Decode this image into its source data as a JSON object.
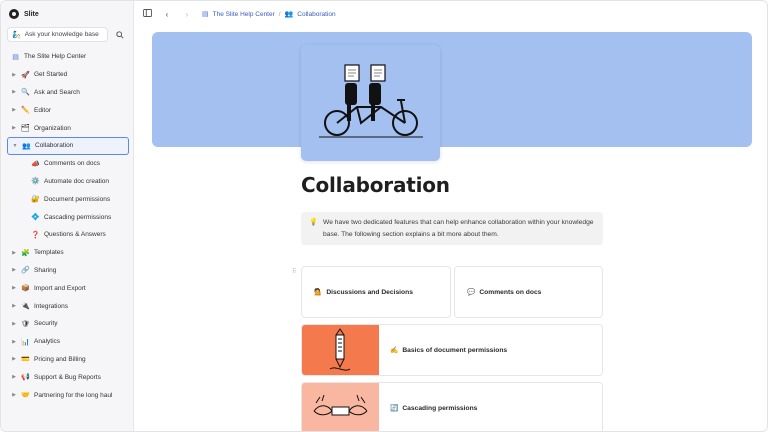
{
  "brand": {
    "name": "Slite"
  },
  "search": {
    "label": "Ask your knowledge base"
  },
  "sidebar": {
    "root": {
      "label": "The Slite Help Center"
    },
    "items": [
      {
        "label": "Get Started",
        "icon": "🚀"
      },
      {
        "label": "Ask and Search",
        "icon": "🔍"
      },
      {
        "label": "Editor",
        "icon": "✏️"
      },
      {
        "label": "Organization",
        "icon": "🗂"
      },
      {
        "label": "Collaboration",
        "icon": "👥"
      },
      {
        "label": "Comments on docs",
        "icon": "📣"
      },
      {
        "label": "Automate doc creation",
        "icon": "⚙️"
      },
      {
        "label": "Document permissions",
        "icon": "🔐"
      },
      {
        "label": "Cascading permissions",
        "icon": "💠"
      },
      {
        "label": "Questions & Answers",
        "icon": "❓"
      },
      {
        "label": "Templates",
        "icon": "🧩"
      },
      {
        "label": "Sharing",
        "icon": "🔗"
      },
      {
        "label": "Import and Export",
        "icon": "📦"
      },
      {
        "label": "Integrations",
        "icon": "🔌"
      },
      {
        "label": "Security",
        "icon": "🛡"
      },
      {
        "label": "Analytics",
        "icon": "📊"
      },
      {
        "label": "Pricing and Billing",
        "icon": "💳"
      },
      {
        "label": "Support & Bug Reports",
        "icon": "📢"
      },
      {
        "label": "Partnering for the long haul",
        "icon": "🤝"
      }
    ]
  },
  "breadcrumb": {
    "items": [
      {
        "label": "The Slite Help Center"
      },
      {
        "label": "Collaboration"
      }
    ],
    "separator": "/"
  },
  "page": {
    "title": "Collaboration",
    "callout": "We have two dedicated features that can help enhance collaboration within your knowledge base. The following section explains a bit more about them."
  },
  "cards": [
    {
      "label": "Discussions and Decisions",
      "icon": "💁"
    },
    {
      "label": "Comments on docs",
      "icon": "💬"
    },
    {
      "label": "Basics of document permissions",
      "icon": "✍️"
    },
    {
      "label": "Cascading permissions",
      "icon": "🔄"
    }
  ],
  "colors": {
    "banner": "#a3c0f0",
    "accent": "#5b8bea",
    "card_thumb_1": "#f4794d",
    "card_thumb_2": "#f9b7a1"
  }
}
